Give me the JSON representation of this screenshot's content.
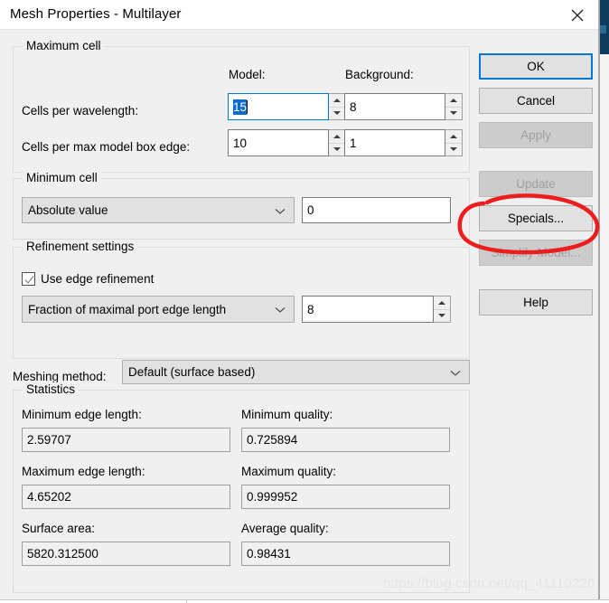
{
  "window": {
    "title": "Mesh Properties - Multilayer",
    "close_icon": "close-icon"
  },
  "maximum_cell": {
    "group_title": "Maximum cell",
    "col_model": "Model:",
    "col_background": "Background:",
    "rows": [
      {
        "label": "Cells per wavelength:",
        "model_value": "15",
        "model_selected": true,
        "background_value": "8"
      },
      {
        "label": "Cells per max model box edge:",
        "model_value": "10",
        "model_selected": false,
        "background_value": "1"
      }
    ]
  },
  "minimum_cell": {
    "group_title": "Minimum cell",
    "mode": "Absolute value",
    "value": "0"
  },
  "refinement": {
    "group_title": "Refinement settings",
    "checkbox_label": "Use edge refinement",
    "checkbox_checked": true,
    "mode": "Fraction of maximal port edge length",
    "value": "8"
  },
  "meshing": {
    "label": "Meshing method:",
    "method": "Default (surface based)"
  },
  "statistics": {
    "group_title": "Statistics",
    "fields": [
      {
        "label": "Minimum edge length:",
        "value": "2.59707"
      },
      {
        "label": "Minimum quality:",
        "value": "0.725894"
      },
      {
        "label": "Maximum edge length:",
        "value": "4.65202"
      },
      {
        "label": "Maximum quality:",
        "value": "0.999952"
      },
      {
        "label": "Surface area:",
        "value": "5820.312500"
      },
      {
        "label": "Average quality:",
        "value": "0.98431"
      }
    ]
  },
  "buttons": [
    {
      "label": "OK",
      "state": "default"
    },
    {
      "label": "Cancel",
      "state": "normal"
    },
    {
      "label": "Apply",
      "state": "disabled"
    },
    {
      "label": "Update",
      "state": "disabled"
    },
    {
      "label": "Specials...",
      "state": "normal"
    },
    {
      "label": "Simplify Model...",
      "state": "disabled"
    },
    {
      "label": "Help",
      "state": "normal"
    }
  ],
  "annotation": {
    "shape": "red-ellipse",
    "color": "#ee1c1c",
    "target": "Specials..."
  },
  "watermark": {
    "text": "https://blog.csdn.net/qq_41110220"
  }
}
